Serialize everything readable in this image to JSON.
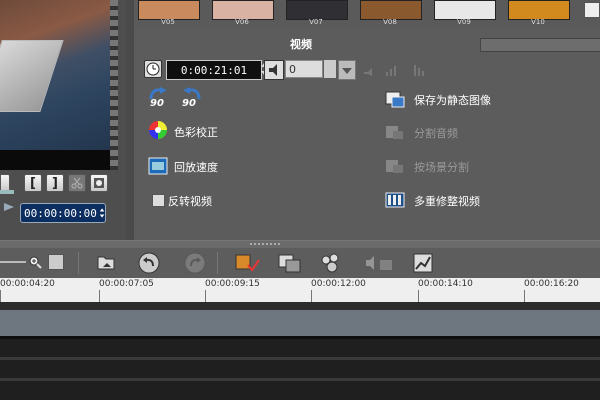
{
  "thumbnails": {
    "items": [
      {
        "label": "V05",
        "color": "#c98a5e"
      },
      {
        "label": "V06",
        "color": "#d9b2a4"
      },
      {
        "label": "V07",
        "color": "#2f2f34"
      },
      {
        "label": "V08",
        "color": "#8a5a2e"
      },
      {
        "label": "V09",
        "color": "#e8e8e8"
      },
      {
        "label": "V10",
        "color": "#d28a1e"
      }
    ]
  },
  "options_panel": {
    "title": "视频",
    "duration": "0:00:21:01",
    "volume": "0",
    "items": {
      "color_correction": "色彩校正",
      "playback_speed": "回放速度",
      "reverse_video": "反转视频",
      "save_still": "保存为静态图像",
      "split_audio": "分割音频",
      "split_by_scene": "按场景分割",
      "multi_trim": "多重修整视频"
    },
    "rotate_left": "90",
    "rotate_right": "90"
  },
  "preview": {
    "timecode": "00:00:00:00",
    "mark_in": "[",
    "mark_out": "]"
  },
  "timeline": {
    "ruler_labels": [
      "00:00:04:20",
      "00:00:07:05",
      "00:00:09:15",
      "00:00:12:00",
      "00:00:14:10",
      "00:00:16:20"
    ]
  },
  "colors": {
    "accent": "#0c2d60",
    "panel_bg": "#5c5c5c"
  }
}
